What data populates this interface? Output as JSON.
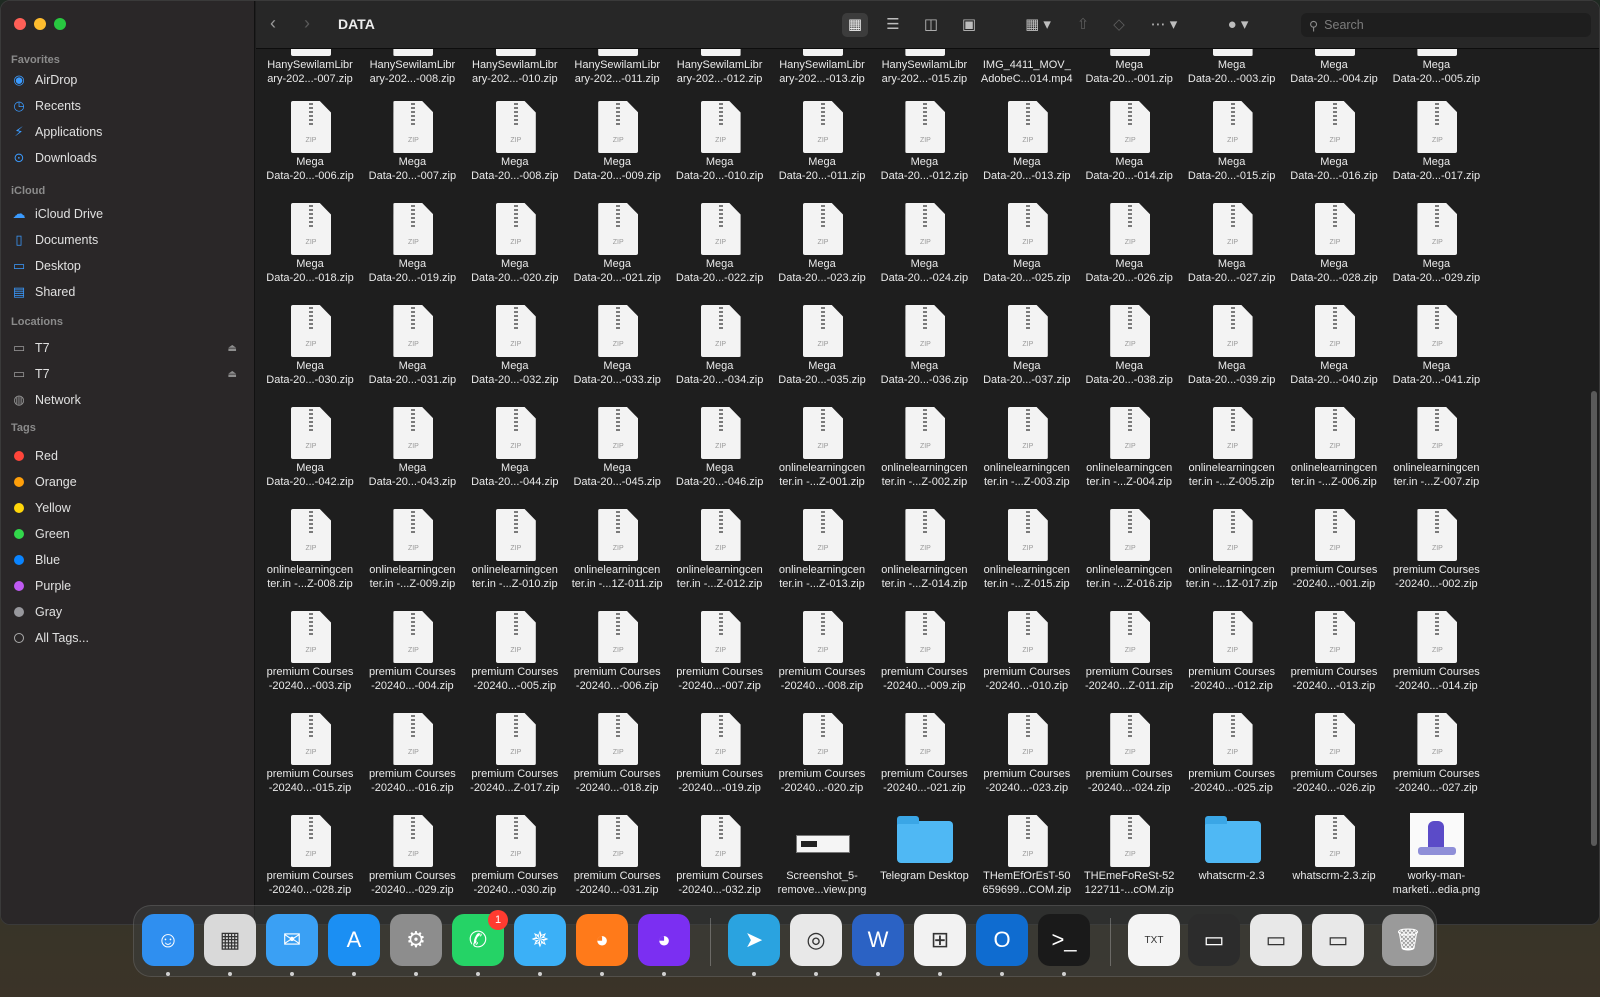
{
  "window": {
    "title": "DATA"
  },
  "search": {
    "placeholder": "Search"
  },
  "sidebar": {
    "favorites_label": "Favorites",
    "favorites": [
      {
        "label": "AirDrop",
        "icon": "airdrop-icon"
      },
      {
        "label": "Recents",
        "icon": "clock-icon"
      },
      {
        "label": "Applications",
        "icon": "applications-icon"
      },
      {
        "label": "Downloads",
        "icon": "download-icon"
      }
    ],
    "icloud_label": "iCloud",
    "icloud": [
      {
        "label": "iCloud Drive",
        "icon": "cloud-icon"
      },
      {
        "label": "Documents",
        "icon": "document-icon"
      },
      {
        "label": "Desktop",
        "icon": "desktop-icon"
      },
      {
        "label": "Shared",
        "icon": "shared-folder-icon"
      }
    ],
    "locations_label": "Locations",
    "locations": [
      {
        "label": "T7",
        "icon": "drive-icon"
      },
      {
        "label": "T7",
        "icon": "drive-icon"
      },
      {
        "label": "Network",
        "icon": "network-icon"
      }
    ],
    "tags_label": "Tags",
    "tags": [
      {
        "label": "Red",
        "color": "#ff453a"
      },
      {
        "label": "Orange",
        "color": "#ff9f0a"
      },
      {
        "label": "Yellow",
        "color": "#ffd60a"
      },
      {
        "label": "Green",
        "color": "#32d74b"
      },
      {
        "label": "Blue",
        "color": "#0a84ff"
      },
      {
        "label": "Purple",
        "color": "#bf5af2"
      },
      {
        "label": "Gray",
        "color": "#98989d"
      },
      {
        "label": "All Tags...",
        "color": ""
      }
    ]
  },
  "files": [
    [
      "HanySewilamLibr\nary-202...-007.zip",
      "HanySewilamLibr\nary-202...-008.zip",
      "HanySewilamLibr\nary-202...-010.zip",
      "HanySewilamLibr\nary-202...-011.zip",
      "HanySewilamLibr\nary-202...-012.zip",
      "HanySewilamLibr\nary-202...-013.zip",
      "HanySewilamLibr\nary-202...-015.zip",
      "IMG_4411_MOV_\nAdobeC...014.mp4",
      "Mega\nData-20...-001.zip",
      "Mega\nData-20...-003.zip",
      "Mega\nData-20...-004.zip",
      "Mega\nData-20...-005.zip"
    ],
    [
      "Mega\nData-20...-006.zip",
      "Mega\nData-20...-007.zip",
      "Mega\nData-20...-008.zip",
      "Mega\nData-20...-009.zip",
      "Mega\nData-20...-010.zip",
      "Mega\nData-20...-011.zip",
      "Mega\nData-20...-012.zip",
      "Mega\nData-20...-013.zip",
      "Mega\nData-20...-014.zip",
      "Mega\nData-20...-015.zip",
      "Mega\nData-20...-016.zip",
      "Mega\nData-20...-017.zip"
    ],
    [
      "Mega\nData-20...-018.zip",
      "Mega\nData-20...-019.zip",
      "Mega\nData-20...-020.zip",
      "Mega\nData-20...-021.zip",
      "Mega\nData-20...-022.zip",
      "Mega\nData-20...-023.zip",
      "Mega\nData-20...-024.zip",
      "Mega\nData-20...-025.zip",
      "Mega\nData-20...-026.zip",
      "Mega\nData-20...-027.zip",
      "Mega\nData-20...-028.zip",
      "Mega\nData-20...-029.zip"
    ],
    [
      "Mega\nData-20...-030.zip",
      "Mega\nData-20...-031.zip",
      "Mega\nData-20...-032.zip",
      "Mega\nData-20...-033.zip",
      "Mega\nData-20...-034.zip",
      "Mega\nData-20...-035.zip",
      "Mega\nData-20...-036.zip",
      "Mega\nData-20...-037.zip",
      "Mega\nData-20...-038.zip",
      "Mega\nData-20...-039.zip",
      "Mega\nData-20...-040.zip",
      "Mega\nData-20...-041.zip"
    ],
    [
      "Mega\nData-20...-042.zip",
      "Mega\nData-20...-043.zip",
      "Mega\nData-20...-044.zip",
      "Mega\nData-20...-045.zip",
      "Mega\nData-20...-046.zip",
      "onlinelearningcen\nter.in -...Z-001.zip",
      "onlinelearningcen\nter.in -...Z-002.zip",
      "onlinelearningcen\nter.in -...Z-003.zip",
      "onlinelearningcen\nter.in -...Z-004.zip",
      "onlinelearningcen\nter.in -...Z-005.zip",
      "onlinelearningcen\nter.in -...Z-006.zip",
      "onlinelearningcen\nter.in -...Z-007.zip"
    ],
    [
      "onlinelearningcen\nter.in -...Z-008.zip",
      "onlinelearningcen\nter.in -...Z-009.zip",
      "onlinelearningcen\nter.in -...Z-010.zip",
      "onlinelearningcen\nter.in -...1Z-011.zip",
      "onlinelearningcen\nter.in -...Z-012.zip",
      "onlinelearningcen\nter.in -...Z-013.zip",
      "onlinelearningcen\nter.in -...Z-014.zip",
      "onlinelearningcen\nter.in -...Z-015.zip",
      "onlinelearningcen\nter.in -...Z-016.zip",
      "onlinelearningcen\nter.in -...1Z-017.zip",
      "premium Courses\n-20240...-001.zip",
      "premium Courses\n-20240...-002.zip"
    ],
    [
      "premium Courses\n-20240...-003.zip",
      "premium Courses\n-20240...-004.zip",
      "premium Courses\n-20240...-005.zip",
      "premium Courses\n-20240...-006.zip",
      "premium Courses\n-20240...-007.zip",
      "premium Courses\n-20240...-008.zip",
      "premium Courses\n-20240...-009.zip",
      "premium Courses\n-20240...-010.zip",
      "premium Courses\n-20240...Z-011.zip",
      "premium Courses\n-20240...-012.zip",
      "premium Courses\n-20240...-013.zip",
      "premium Courses\n-20240...-014.zip"
    ],
    [
      "premium Courses\n-20240...-015.zip",
      "premium Courses\n-20240...-016.zip",
      "premium Courses\n-20240...Z-017.zip",
      "premium Courses\n-20240...-018.zip",
      "premium Courses\n-20240...-019.zip",
      "premium Courses\n-20240...-020.zip",
      "premium Courses\n-20240...-021.zip",
      "premium Courses\n-20240...-023.zip",
      "premium Courses\n-20240...-024.zip",
      "premium Courses\n-20240...-025.zip",
      "premium Courses\n-20240...-026.zip",
      "premium Courses\n-20240...-027.zip"
    ],
    [
      "premium Courses\n-20240...-028.zip",
      "premium Courses\n-20240...-029.zip",
      "premium Courses\n-20240...-030.zip",
      "premium Courses\n-20240...-031.zip",
      "premium Courses\n-20240...-032.zip",
      "Screenshot_5-\nremove...view.png",
      "Telegram Desktop",
      "THemEfOrEsT-50\n659699...COM.zip",
      "THEmeFoReSt-52\n122711-...cOM.zip",
      "whatscrm-2.3",
      "whatscrm-2.3.zip",
      "worky-man-\nmarketi...edia.png"
    ]
  ],
  "dock": {
    "apps": [
      {
        "name": "finder",
        "icon": "finder-icon",
        "bg": "#2f8ff0"
      },
      {
        "name": "launchpad",
        "icon": "launchpad-icon",
        "bg": "#d9d9d9"
      },
      {
        "name": "mail",
        "icon": "mail-icon",
        "bg": "#3aa0f4"
      },
      {
        "name": "app-store",
        "icon": "app-store-icon",
        "bg": "#1b8ff3"
      },
      {
        "name": "system-settings",
        "icon": "gear-icon",
        "bg": "#8d8d8d"
      },
      {
        "name": "whatsapp",
        "icon": "whatsapp-icon",
        "bg": "#25d366",
        "badge": "1"
      },
      {
        "name": "safari",
        "icon": "compass-icon",
        "bg": "#3bb0f7"
      },
      {
        "name": "firefox",
        "icon": "firefox-icon",
        "bg": "#ff7a1a"
      },
      {
        "name": "firefox-dev",
        "icon": "firefox-icon",
        "bg": "#7b2ff2"
      },
      {
        "name": "telegram",
        "icon": "paper-plane-icon",
        "bg": "#2aa3e0"
      },
      {
        "name": "chrome",
        "icon": "chrome-icon",
        "bg": "#e8e8e8"
      },
      {
        "name": "word",
        "icon": "word-icon",
        "bg": "#2b62c4"
      },
      {
        "name": "windows-app",
        "icon": "windows-icon",
        "bg": "#f2f2f2"
      },
      {
        "name": "outlook",
        "icon": "outlook-icon",
        "bg": "#0f6cd0"
      },
      {
        "name": "terminal",
        "icon": "terminal-icon",
        "bg": "#1a1a1a"
      },
      {
        "name": "text-file",
        "icon": "text-file-icon",
        "bg": "#f4f4f4"
      },
      {
        "name": "minimized-window-1",
        "icon": "window-thumbnail-icon",
        "bg": "#2c2c2c"
      },
      {
        "name": "minimized-window-2",
        "icon": "window-thumbnail-icon",
        "bg": "#e8e8e8"
      },
      {
        "name": "minimized-window-3",
        "icon": "window-thumbnail-icon",
        "bg": "#e8e8e8"
      },
      {
        "name": "trash",
        "icon": "trash-icon",
        "bg": "#9a9a9a"
      }
    ]
  }
}
